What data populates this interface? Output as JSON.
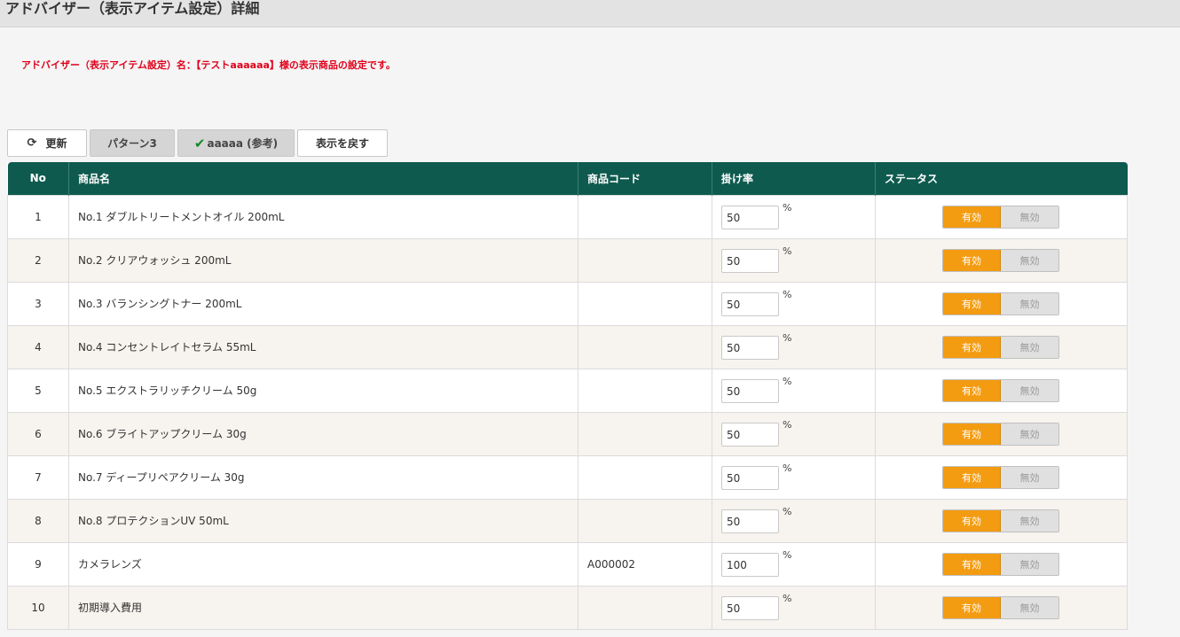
{
  "page": {
    "title": "アドバイザー（表示アイテム設定）詳細",
    "notice": "アドバイザー（表示アイテム設定）名：【テストaaaaaa】様の表示商品の設定です。"
  },
  "toolbar": {
    "refresh_label": "更新",
    "pattern_label": "パターン3",
    "reference_label": "aaaaa (参考)",
    "reset_label": "表示を戻す"
  },
  "table": {
    "headers": {
      "no": "No",
      "name": "商品名",
      "code": "商品コード",
      "rate": "掛け率",
      "status": "ステータス"
    },
    "percent_unit": "%",
    "status_on": "有効",
    "status_off": "無効",
    "rows": [
      {
        "no": "1",
        "name": "No.1 ダブルトリートメントオイル 200mL",
        "code": "",
        "rate": "50",
        "status": "有効"
      },
      {
        "no": "2",
        "name": "No.2 クリアウォッシュ 200mL",
        "code": "",
        "rate": "50",
        "status": "有効"
      },
      {
        "no": "3",
        "name": "No.3 バランシングトナー 200mL",
        "code": "",
        "rate": "50",
        "status": "有効"
      },
      {
        "no": "4",
        "name": "No.4 コンセントレイトセラム 55mL",
        "code": "",
        "rate": "50",
        "status": "有効"
      },
      {
        "no": "5",
        "name": "No.5 エクストラリッチクリーム 50g",
        "code": "",
        "rate": "50",
        "status": "有効"
      },
      {
        "no": "6",
        "name": "No.6 ブライトアップクリーム 30g",
        "code": "",
        "rate": "50",
        "status": "有効"
      },
      {
        "no": "7",
        "name": "No.7 ディープリペアクリーム 30g",
        "code": "",
        "rate": "50",
        "status": "有効"
      },
      {
        "no": "8",
        "name": "No.8 プロテクションUV 50mL",
        "code": "",
        "rate": "50",
        "status": "有効"
      },
      {
        "no": "9",
        "name": "カメラレンズ",
        "code": "A000002",
        "rate": "100",
        "status": "有効"
      },
      {
        "no": "10",
        "name": "初期導入費用",
        "code": "",
        "rate": "50",
        "status": "有効"
      }
    ]
  },
  "colors": {
    "header_bg": "#0e5a4e",
    "active_status": "#f39c12",
    "notice_text": "#e0001a"
  },
  "icons": {
    "refresh": "refresh-icon",
    "check": "check-icon"
  }
}
